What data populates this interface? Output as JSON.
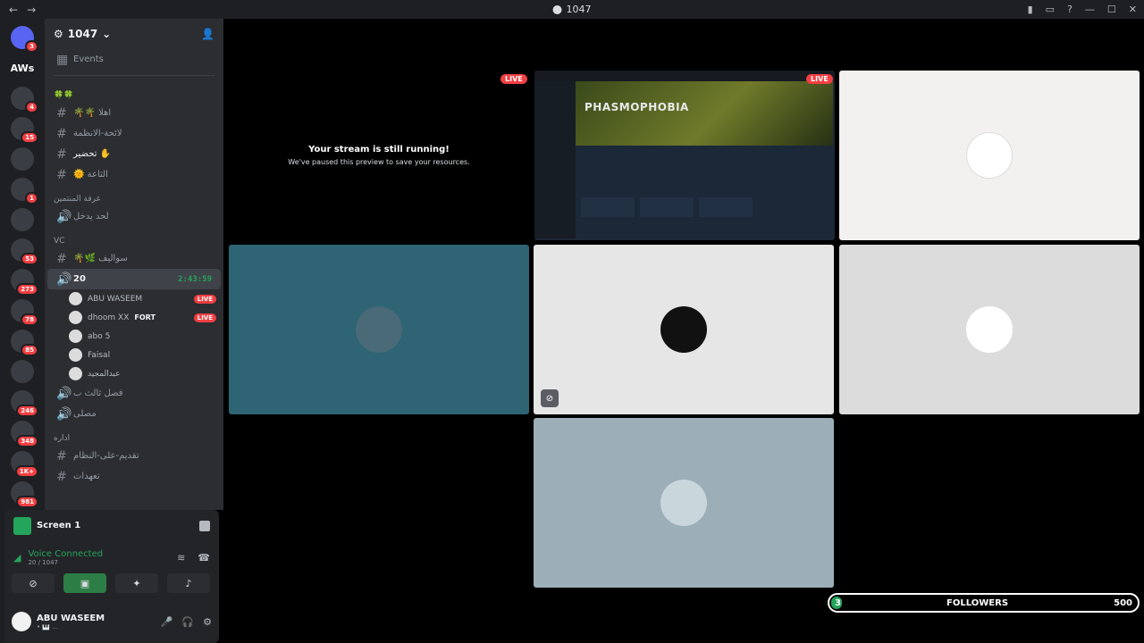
{
  "window": {
    "title": "1047",
    "back": "←",
    "forward": "→"
  },
  "titlebar_icons": [
    "bookmark-icon",
    "inbox-icon",
    "help-icon",
    "minimize-icon",
    "maximize-icon",
    "close-icon"
  ],
  "servers": [
    {
      "name": "direct-messages",
      "badge": "3"
    },
    {
      "name": "AWs",
      "badge": ""
    },
    {
      "name": "server-1",
      "badge": "4"
    },
    {
      "name": "server-2",
      "badge": "15"
    },
    {
      "name": "server-3",
      "badge": ""
    },
    {
      "name": "server-4",
      "badge": "1"
    },
    {
      "name": "server-5",
      "badge": ""
    },
    {
      "name": "server-6",
      "badge": "53"
    },
    {
      "name": "server-7",
      "badge": "273"
    },
    {
      "name": "server-8",
      "badge": "78"
    },
    {
      "name": "server-9",
      "badge": "85"
    },
    {
      "name": "server-10",
      "badge": ""
    },
    {
      "name": "server-11",
      "badge": "246"
    },
    {
      "name": "server-12",
      "badge": "348"
    },
    {
      "name": "server-13",
      "badge": "1K+"
    },
    {
      "name": "server-14",
      "badge": "981"
    },
    {
      "name": "server-15",
      "badge": ""
    }
  ],
  "guild": {
    "name": "1047",
    "events": "Events"
  },
  "channels": {
    "cat1": "🍀🍀",
    "c1": "🌴🌴 اهلا",
    "c2": "لائحة-الانظمة",
    "c3": "تحضير ✋",
    "c4": "🌞 الثاعة",
    "cat2": "غرفة المنتمين",
    "c5": "لحد يدخل",
    "cat3": "VC",
    "c6": "🌴🌿 سواليف",
    "voice_active": "20",
    "voice_timer": "2:43:59",
    "c7": "فصل ثالث ب",
    "c8": "مصلى",
    "cat4": "اداره",
    "c9": "تقديم-على-النظام",
    "c10": "تعهدات"
  },
  "voice_users": [
    {
      "name": "ABU WASEEM",
      "live": "LIVE",
      "extra": ""
    },
    {
      "name": "dhoom XX",
      "tag": "FORT",
      "live": "LIVE",
      "extra": ""
    },
    {
      "name": "abo 5",
      "live": "",
      "extra": ""
    },
    {
      "name": "Faisal",
      "live": "",
      "extra": ""
    },
    {
      "name": "عبدالمجيد",
      "live": "",
      "extra": ""
    }
  ],
  "panel": {
    "screen_label": "Screen 1",
    "voice_status": "Voice Connected",
    "voice_sub": "20 / 1047",
    "user_name": "ABU WASEEM",
    "user_status": "• 🎹 ..."
  },
  "stage": {
    "paused_title": "Your stream is still running!",
    "paused_sub": "We've paused this preview to save your resources.",
    "live": "LIVE",
    "game_title": "PHASMOPHOBIA",
    "followers_current": "3",
    "followers_label": "FOLLOWERS",
    "followers_goal": "500",
    "followers_progress": 0.006
  },
  "colors": {
    "tile_teal": "#2e6474",
    "tile_light": "#f2f1ef",
    "tile_gray1": "#e6e6e6",
    "tile_gray2": "#dcdcdc",
    "tile_blue": "#9cafb8",
    "live_red": "#f23f43",
    "voice_green": "#23a55a"
  }
}
